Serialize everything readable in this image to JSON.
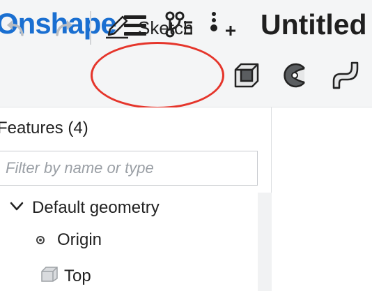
{
  "app": {
    "logo_text": "Onshape",
    "document_title": "Untitled",
    "brand_color": "#1a6fd1"
  },
  "topbar": {
    "icons": [
      "menu-icon",
      "version-graph-icon",
      "insert-icon"
    ]
  },
  "toolbar": {
    "undo_icon": "undo-icon",
    "redo_icon": "redo-icon",
    "sketch_label": "Sketch",
    "sketch_icon": "pencil-icon",
    "tools": [
      "extrude-icon",
      "revolve-icon",
      "sweep-icon"
    ],
    "highlight_color": "#e5352b"
  },
  "feature_panel": {
    "title": "Features (4)",
    "filter_placeholder": "Filter by name or type",
    "tree": [
      {
        "label": "Default geometry",
        "icon": "chevron-down-icon"
      },
      {
        "label": "Origin",
        "icon": "origin-point-icon"
      },
      {
        "label": "Top",
        "icon": "plane-icon"
      }
    ]
  }
}
